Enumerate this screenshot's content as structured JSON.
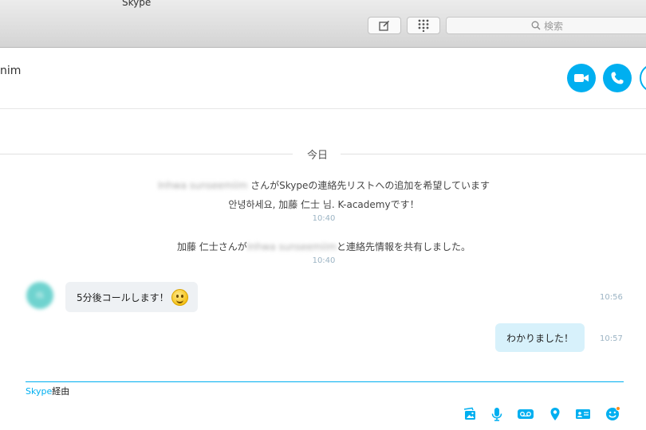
{
  "window": {
    "app_title": "Skype"
  },
  "toolbar": {
    "search_placeholder": "検索",
    "compose_icon": "compose-icon",
    "dialpad_icon": "dialpad-icon"
  },
  "conversation": {
    "contact_name_visible": "nim"
  },
  "chat": {
    "date_divider": "今日",
    "system_events": [
      {
        "blurred_name": "Inhwa sunseemiim",
        "text": " さんがSkypeの連絡先リストへの追加を希望しています",
        "second_line": "안녕하세요, 加藤 仁士 님. K-academyです！",
        "time": "10:40"
      },
      {
        "prefix": "加藤 仁士さんが",
        "blurred_name": "Inhwa sunseemiim",
        "suffix": "と連絡先情報を共有しました。",
        "time": "10:40"
      }
    ],
    "messages": [
      {
        "direction": "incoming",
        "avatar_initials": "IS",
        "text": "5分後コールします！",
        "emoji": "smile-emoji",
        "time": "10:56"
      },
      {
        "direction": "outgoing",
        "text": "わかりました！",
        "time": "10:57"
      }
    ]
  },
  "composer": {
    "via_brand": "Skype",
    "via_suffix": "経由"
  },
  "colors": {
    "accent": "#00aff0",
    "incoming_bubble": "#eef1f4",
    "outgoing_bubble": "#d7f1fb"
  }
}
